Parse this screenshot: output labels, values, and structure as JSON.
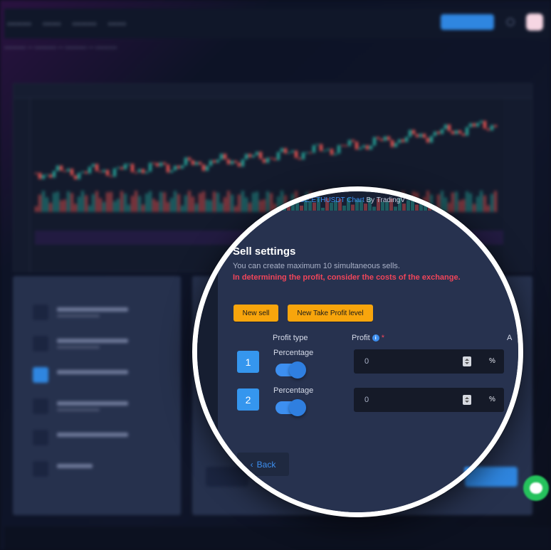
{
  "background": {
    "colors": {
      "accent": "#2f86e0",
      "panel": "#26314d",
      "candle_up": "#26a69a",
      "candle_down": "#ef5350"
    }
  },
  "chart_credit": {
    "symbol_link": "ICE:ETHUSDT Chart",
    "by_text": "By TradingV"
  },
  "sell_settings": {
    "title": "Sell settings",
    "subtitle": "You can create maximum 10 simultaneous sells.",
    "warning": "In determining the profit, consider the costs of the exchange.",
    "buttons": {
      "new_sell": "New sell",
      "new_take_profit": "New Take Profit level"
    },
    "columns": {
      "profit_type": "Profit type",
      "profit": "Profit",
      "profit_info": "i",
      "profit_required": "*",
      "next_col_initial": "A"
    },
    "rows": [
      {
        "number": "1",
        "type_label": "Percentage",
        "value_placeholder": "0",
        "unit": "%"
      },
      {
        "number": "2",
        "type_label": "Percentage",
        "value_placeholder": "0",
        "unit": "%"
      }
    ],
    "back_label": "Back",
    "back_icon": "chevron-left-icon"
  },
  "colors": {
    "orange_button": "#f8a50c",
    "warning_text": "#f0455a",
    "badge_blue": "#3596ee",
    "input_bg": "#151a28"
  }
}
